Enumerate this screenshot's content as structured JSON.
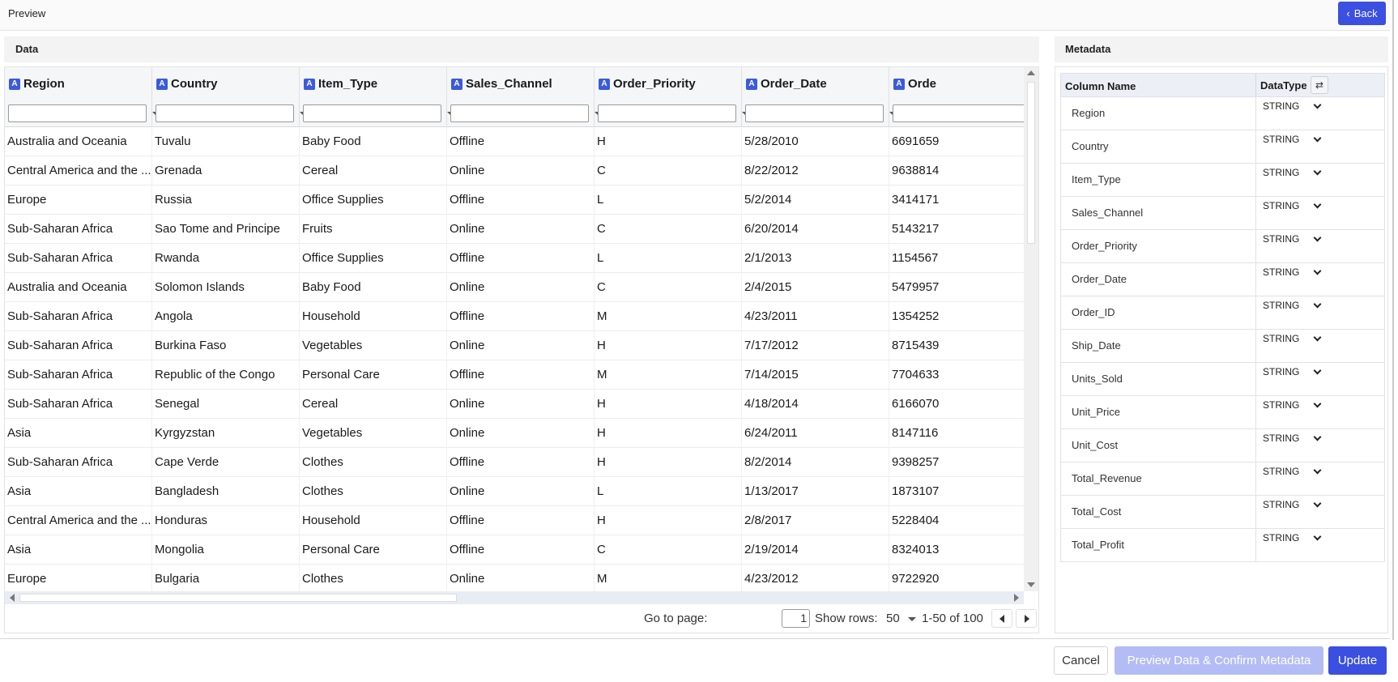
{
  "topbar": {
    "title": "Preview",
    "back_label": "Back"
  },
  "data_panel": {
    "title": "Data",
    "columns": [
      "Region",
      "Country",
      "Item_Type",
      "Sales_Channel",
      "Order_Priority",
      "Order_Date",
      "Orde"
    ],
    "rows": [
      [
        "Australia and Oceania",
        "Tuvalu",
        "Baby Food",
        "Offline",
        "H",
        "5/28/2010",
        "6691659"
      ],
      [
        "Central America and the ...",
        "Grenada",
        "Cereal",
        "Online",
        "C",
        "8/22/2012",
        "9638814"
      ],
      [
        "Europe",
        "Russia",
        "Office Supplies",
        "Offline",
        "L",
        "5/2/2014",
        "3414171"
      ],
      [
        "Sub-Saharan Africa",
        "Sao Tome and Principe",
        "Fruits",
        "Online",
        "C",
        "6/20/2014",
        "5143217"
      ],
      [
        "Sub-Saharan Africa",
        "Rwanda",
        "Office Supplies",
        "Offline",
        "L",
        "2/1/2013",
        "1154567"
      ],
      [
        "Australia and Oceania",
        "Solomon Islands",
        "Baby Food",
        "Online",
        "C",
        "2/4/2015",
        "5479957"
      ],
      [
        "Sub-Saharan Africa",
        "Angola",
        "Household",
        "Offline",
        "M",
        "4/23/2011",
        "1354252"
      ],
      [
        "Sub-Saharan Africa",
        "Burkina Faso",
        "Vegetables",
        "Online",
        "H",
        "7/17/2012",
        "8715439"
      ],
      [
        "Sub-Saharan Africa",
        "Republic of the Congo",
        "Personal Care",
        "Offline",
        "M",
        "7/14/2015",
        "7704633"
      ],
      [
        "Sub-Saharan Africa",
        "Senegal",
        "Cereal",
        "Online",
        "H",
        "4/18/2014",
        "6166070"
      ],
      [
        "Asia",
        "Kyrgyzstan",
        "Vegetables",
        "Online",
        "H",
        "6/24/2011",
        "8147116"
      ],
      [
        "Sub-Saharan Africa",
        "Cape Verde",
        "Clothes",
        "Offline",
        "H",
        "8/2/2014",
        "9398257"
      ],
      [
        "Asia",
        "Bangladesh",
        "Clothes",
        "Online",
        "L",
        "1/13/2017",
        "1873107"
      ],
      [
        "Central America and the ...",
        "Honduras",
        "Household",
        "Offline",
        "H",
        "2/8/2017",
        "5228404"
      ],
      [
        "Asia",
        "Mongolia",
        "Personal Care",
        "Offline",
        "C",
        "2/19/2014",
        "8324013"
      ],
      [
        "Europe",
        "Bulgaria",
        "Clothes",
        "Online",
        "M",
        "4/23/2012",
        "9722920"
      ]
    ],
    "pager": {
      "goto_label": "Go to page:",
      "page_value": "1",
      "show_rows_label": "Show rows:",
      "rows_value": "50",
      "range_label": "1-50 of 100"
    }
  },
  "meta_panel": {
    "title": "Metadata",
    "col_name_header": "Column Name",
    "datatype_header": "DataType",
    "rows": [
      {
        "name": "Region",
        "type": "STRING"
      },
      {
        "name": "Country",
        "type": "STRING"
      },
      {
        "name": "Item_Type",
        "type": "STRING"
      },
      {
        "name": "Sales_Channel",
        "type": "STRING"
      },
      {
        "name": "Order_Priority",
        "type": "STRING"
      },
      {
        "name": "Order_Date",
        "type": "STRING"
      },
      {
        "name": "Order_ID",
        "type": "STRING"
      },
      {
        "name": "Ship_Date",
        "type": "STRING"
      },
      {
        "name": "Units_Sold",
        "type": "STRING"
      },
      {
        "name": "Unit_Price",
        "type": "STRING"
      },
      {
        "name": "Unit_Cost",
        "type": "STRING"
      },
      {
        "name": "Total_Revenue",
        "type": "STRING"
      },
      {
        "name": "Total_Cost",
        "type": "STRING"
      },
      {
        "name": "Total_Profit",
        "type": "STRING"
      }
    ]
  },
  "footer": {
    "cancel_label": "Cancel",
    "preview_label": "Preview Data & Confirm Metadata",
    "update_label": "Update"
  },
  "colors": {
    "accent": "#3b4fe0",
    "accent_disabled": "#b3bcf5",
    "type_icon": "#3b5bdb"
  },
  "icons": {
    "column_type": "string-type-icon",
    "back": "chevron-left-icon",
    "shuffle": "shuffle-icon"
  }
}
